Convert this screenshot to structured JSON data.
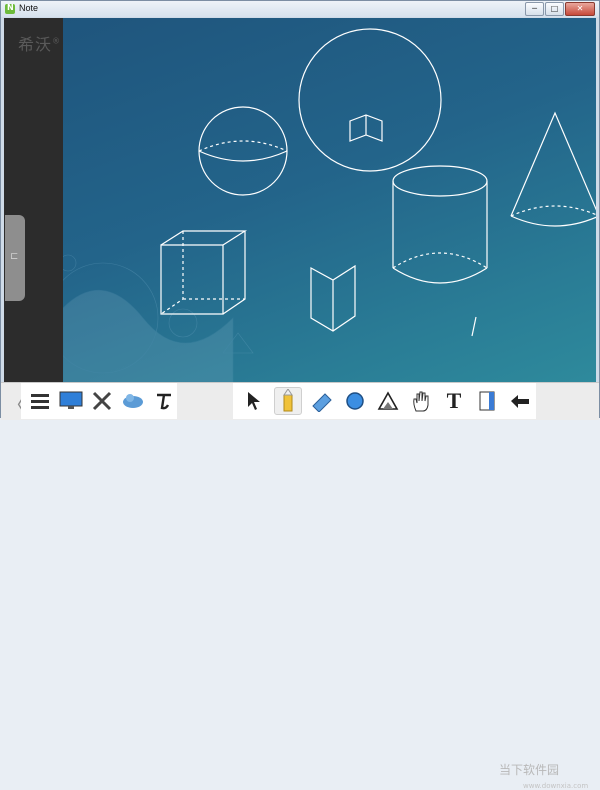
{
  "window": {
    "title": "Note",
    "app_icon_letter": "N"
  },
  "window_buttons": [
    "─",
    "□",
    "✕"
  ],
  "side": {
    "logo": "希沃",
    "logo_mark": "®",
    "handle_icon": "⊏"
  },
  "toolbar": {
    "left_tools": [
      "menu-icon",
      "monitor-icon",
      "tools-icon",
      "cloud-icon",
      "text-recognition-icon"
    ],
    "right_tools": [
      "cursor-icon",
      "pen-icon",
      "eraser-icon",
      "shape-circle-icon",
      "triangle-icon",
      "hand-icon",
      "text-icon",
      "page-icon",
      "undo-icon"
    ],
    "active_tool": "pen-icon",
    "text_tool_glyph": "T",
    "back_glyph": "〈"
  },
  "watermark": {
    "main": "当下软件园",
    "sub": "www.downxia.com"
  },
  "colors": {
    "canvas_top": "#1f557d",
    "canvas_bottom": "#2e8a9c",
    "sidebar": "#2c2c2c",
    "line": "#ffffff"
  }
}
